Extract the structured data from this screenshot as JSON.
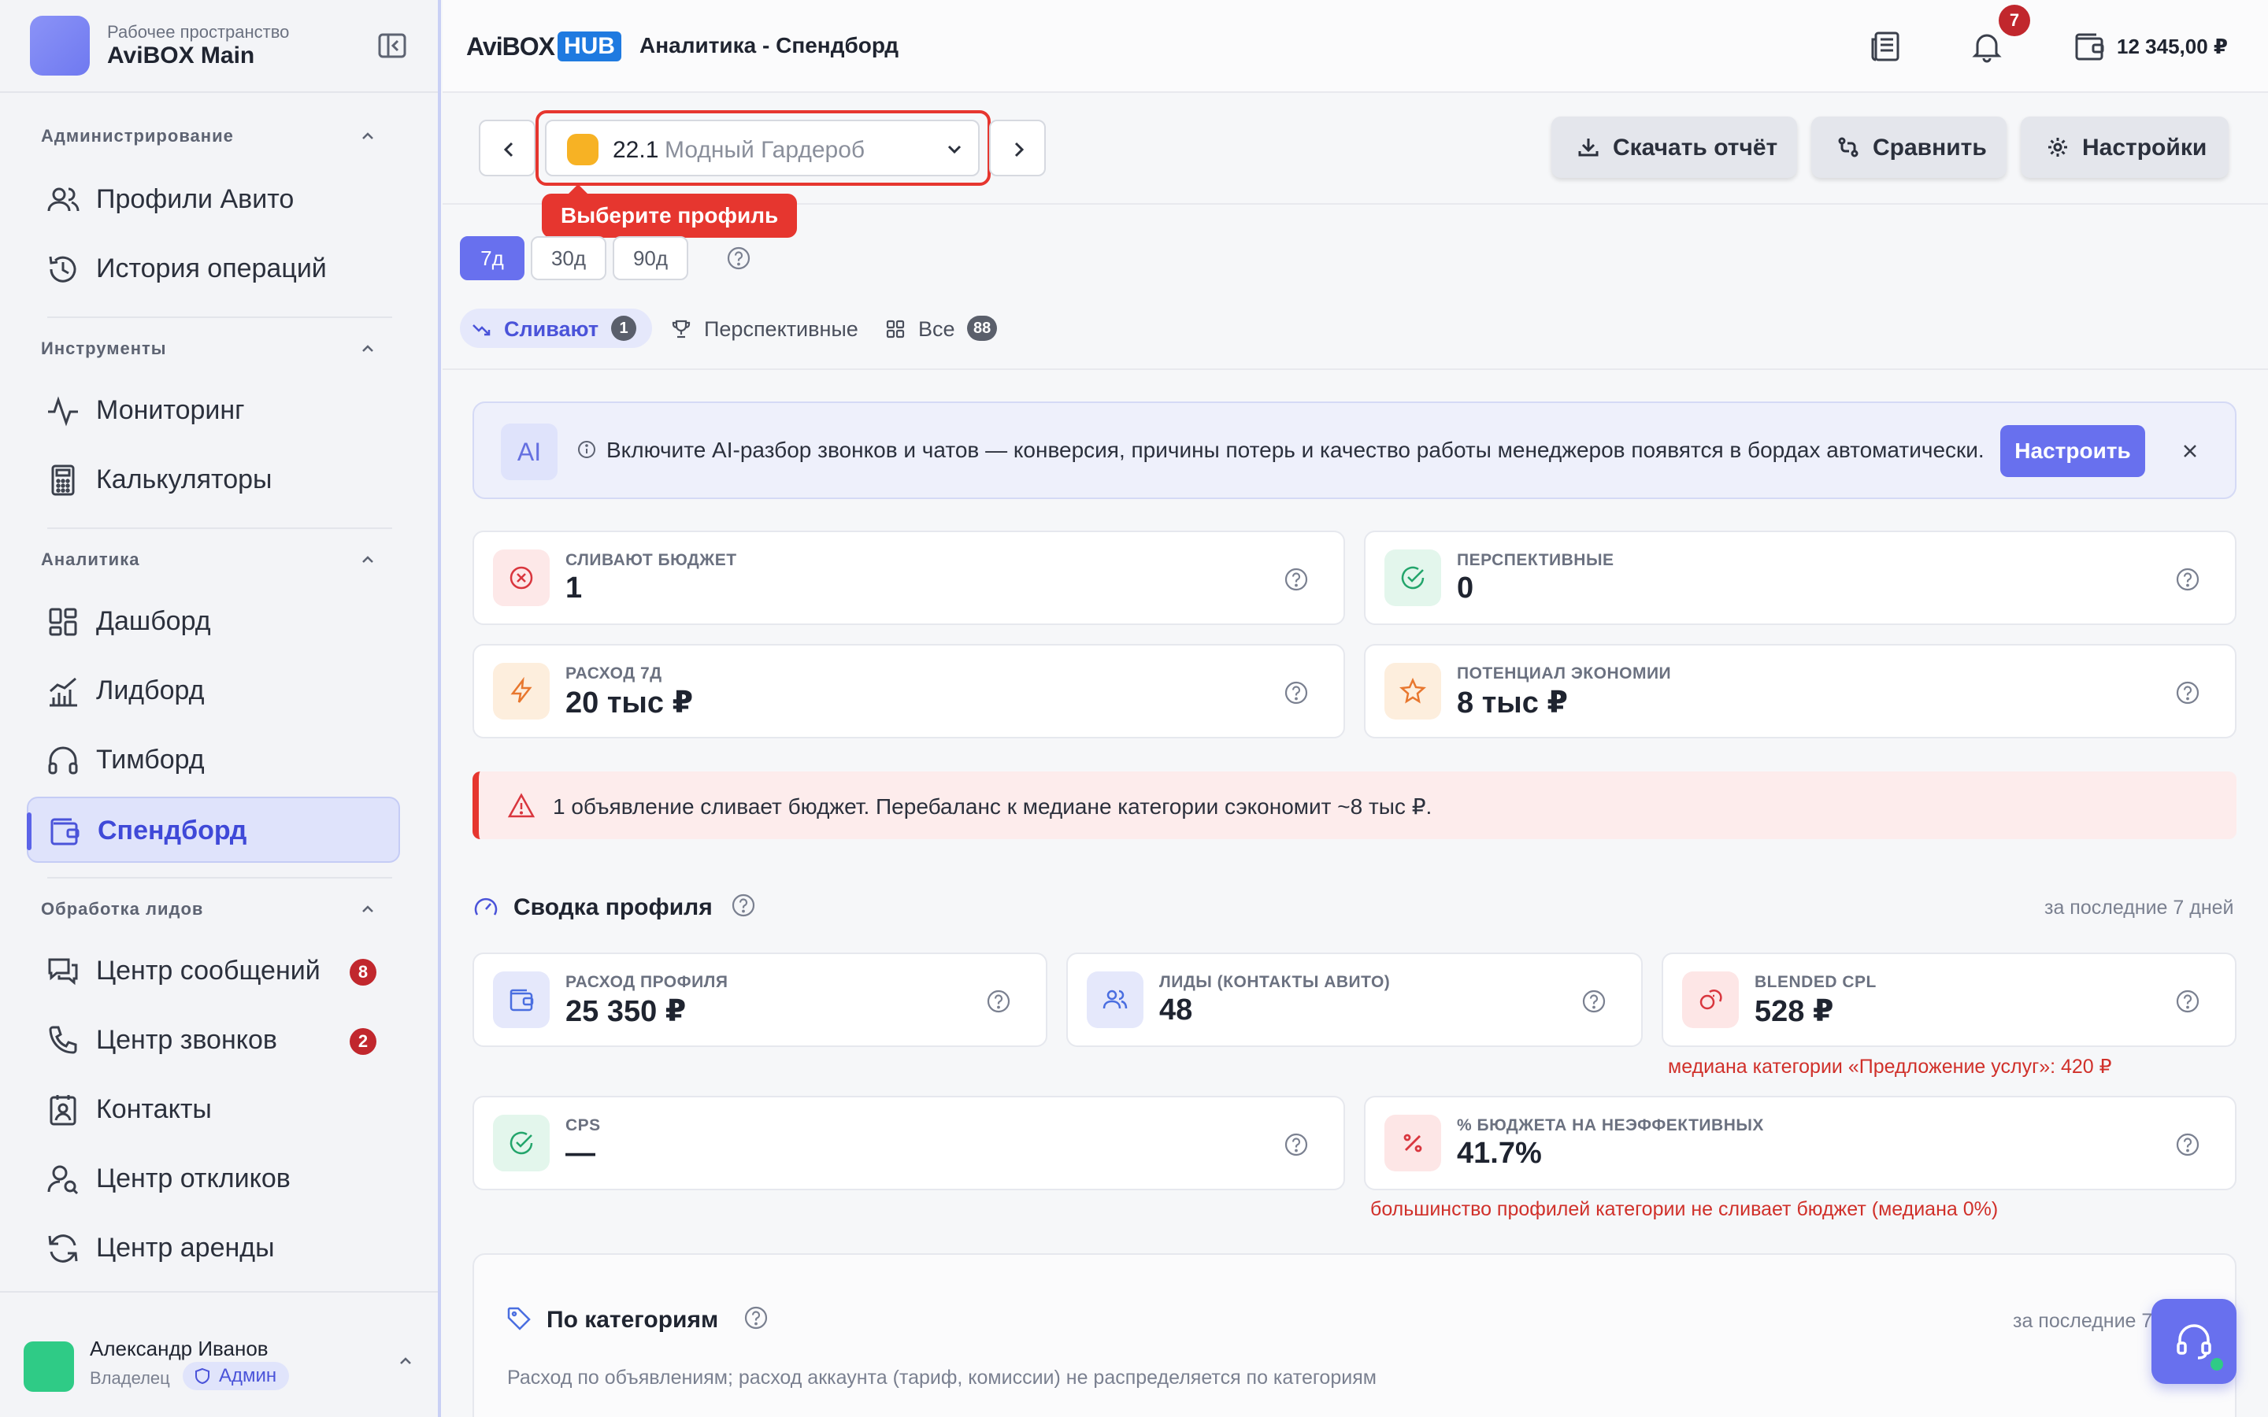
{
  "workspace": {
    "caption": "Рабочее пространство",
    "name": "AviBOX Main"
  },
  "sidebar": {
    "sections": [
      {
        "title": "Администрирование",
        "items": [
          {
            "label": "Профили Авито",
            "icon": "users-icon"
          },
          {
            "label": "История операций",
            "icon": "history-icon"
          }
        ]
      },
      {
        "title": "Инструменты",
        "items": [
          {
            "label": "Мониторинг",
            "icon": "activity-icon"
          },
          {
            "label": "Калькуляторы",
            "icon": "calculator-icon"
          }
        ]
      },
      {
        "title": "Аналитика",
        "items": [
          {
            "label": "Дашборд",
            "icon": "dashboard-icon"
          },
          {
            "label": "Лидборд",
            "icon": "chart-icon"
          },
          {
            "label": "Тимборд",
            "icon": "headphones-icon"
          },
          {
            "label": "Спендборд",
            "icon": "wallet-icon",
            "active": true
          }
        ]
      },
      {
        "title": "Обработка лидов",
        "items": [
          {
            "label": "Центр сообщений",
            "icon": "messages-icon",
            "badge": "8"
          },
          {
            "label": "Центр звонков",
            "icon": "phone-icon",
            "badge": "2"
          },
          {
            "label": "Контакты",
            "icon": "contacts-icon"
          },
          {
            "label": "Центр откликов",
            "icon": "user-search-icon"
          },
          {
            "label": "Центр аренды",
            "icon": "refresh-icon"
          }
        ]
      }
    ]
  },
  "user": {
    "name": "Александр Иванов",
    "role": "Владелец",
    "badge": "Админ"
  },
  "topbar": {
    "brand_a": "AviBOX",
    "brand_b": "HUB",
    "title": "Аналитика - Спендборд",
    "notifications_count": "7",
    "balance": "12 345,00 ₽"
  },
  "profile_select": {
    "number": "22.1",
    "name": "Модный Гардероб",
    "tooltip": "Выберите профиль"
  },
  "actions": {
    "download": "Скачать отчёт",
    "compare": "Сравнить",
    "settings": "Настройки"
  },
  "periods": [
    "7д",
    "30д",
    "90д"
  ],
  "active_period": "7д",
  "filters": [
    {
      "label": "Сливают",
      "badge": "1",
      "active": true
    },
    {
      "label": "Перспективные"
    },
    {
      "label": "Все",
      "badge": "88"
    }
  ],
  "ai_banner": {
    "tag": "AI",
    "text": "Включите AI-разбор звонков и чатов — конверсия, причины потерь и качество работы менеджеров появятся в бордах автоматически.",
    "button": "Настроить"
  },
  "kpis": [
    {
      "label": "СЛИВАЮТ БЮДЖЕТ",
      "value": "1"
    },
    {
      "label": "ПЕРСПЕКТИВНЫЕ",
      "value": "0"
    },
    {
      "label": "РАСХОД 7Д",
      "value": "20 тыс ₽"
    },
    {
      "label": "ПОТЕНЦИАЛ ЭКОНОМИИ",
      "value": "8 тыс ₽"
    }
  ],
  "warning": "1 объявление сливает бюджет. Перебаланс к медиане категории сэкономит ~8 тыс ₽.",
  "summary": {
    "title": "Сводка профиля",
    "period": "за последние 7 дней",
    "cards": [
      {
        "label": "РАСХОД ПРОФИЛЯ",
        "value": "25 350 ₽"
      },
      {
        "label": "ЛИДЫ (КОНТАКТЫ АВИТО)",
        "value": "48"
      },
      {
        "label": "BLENDED CPL",
        "value": "528 ₽",
        "note": "медиана категории «Предложение услуг»: 420 ₽"
      },
      {
        "label": "CPS",
        "value": "—"
      },
      {
        "label": "% БЮДЖЕТА НА НЕЭФФЕКТИВНЫХ",
        "value": "41.7%",
        "note": "большинство профилей категории не сливает бюджет (медиана 0%)"
      }
    ]
  },
  "categories": {
    "title": "По категориям",
    "period": "за последние 7",
    "subtitle": "Расход по объявлениям; расход аккаунта (тариф, комиссии) не распределяется по категориям"
  },
  "colors": {
    "accent": "#6870ee",
    "danger": "#e6362f",
    "badge": "#c1272d"
  }
}
